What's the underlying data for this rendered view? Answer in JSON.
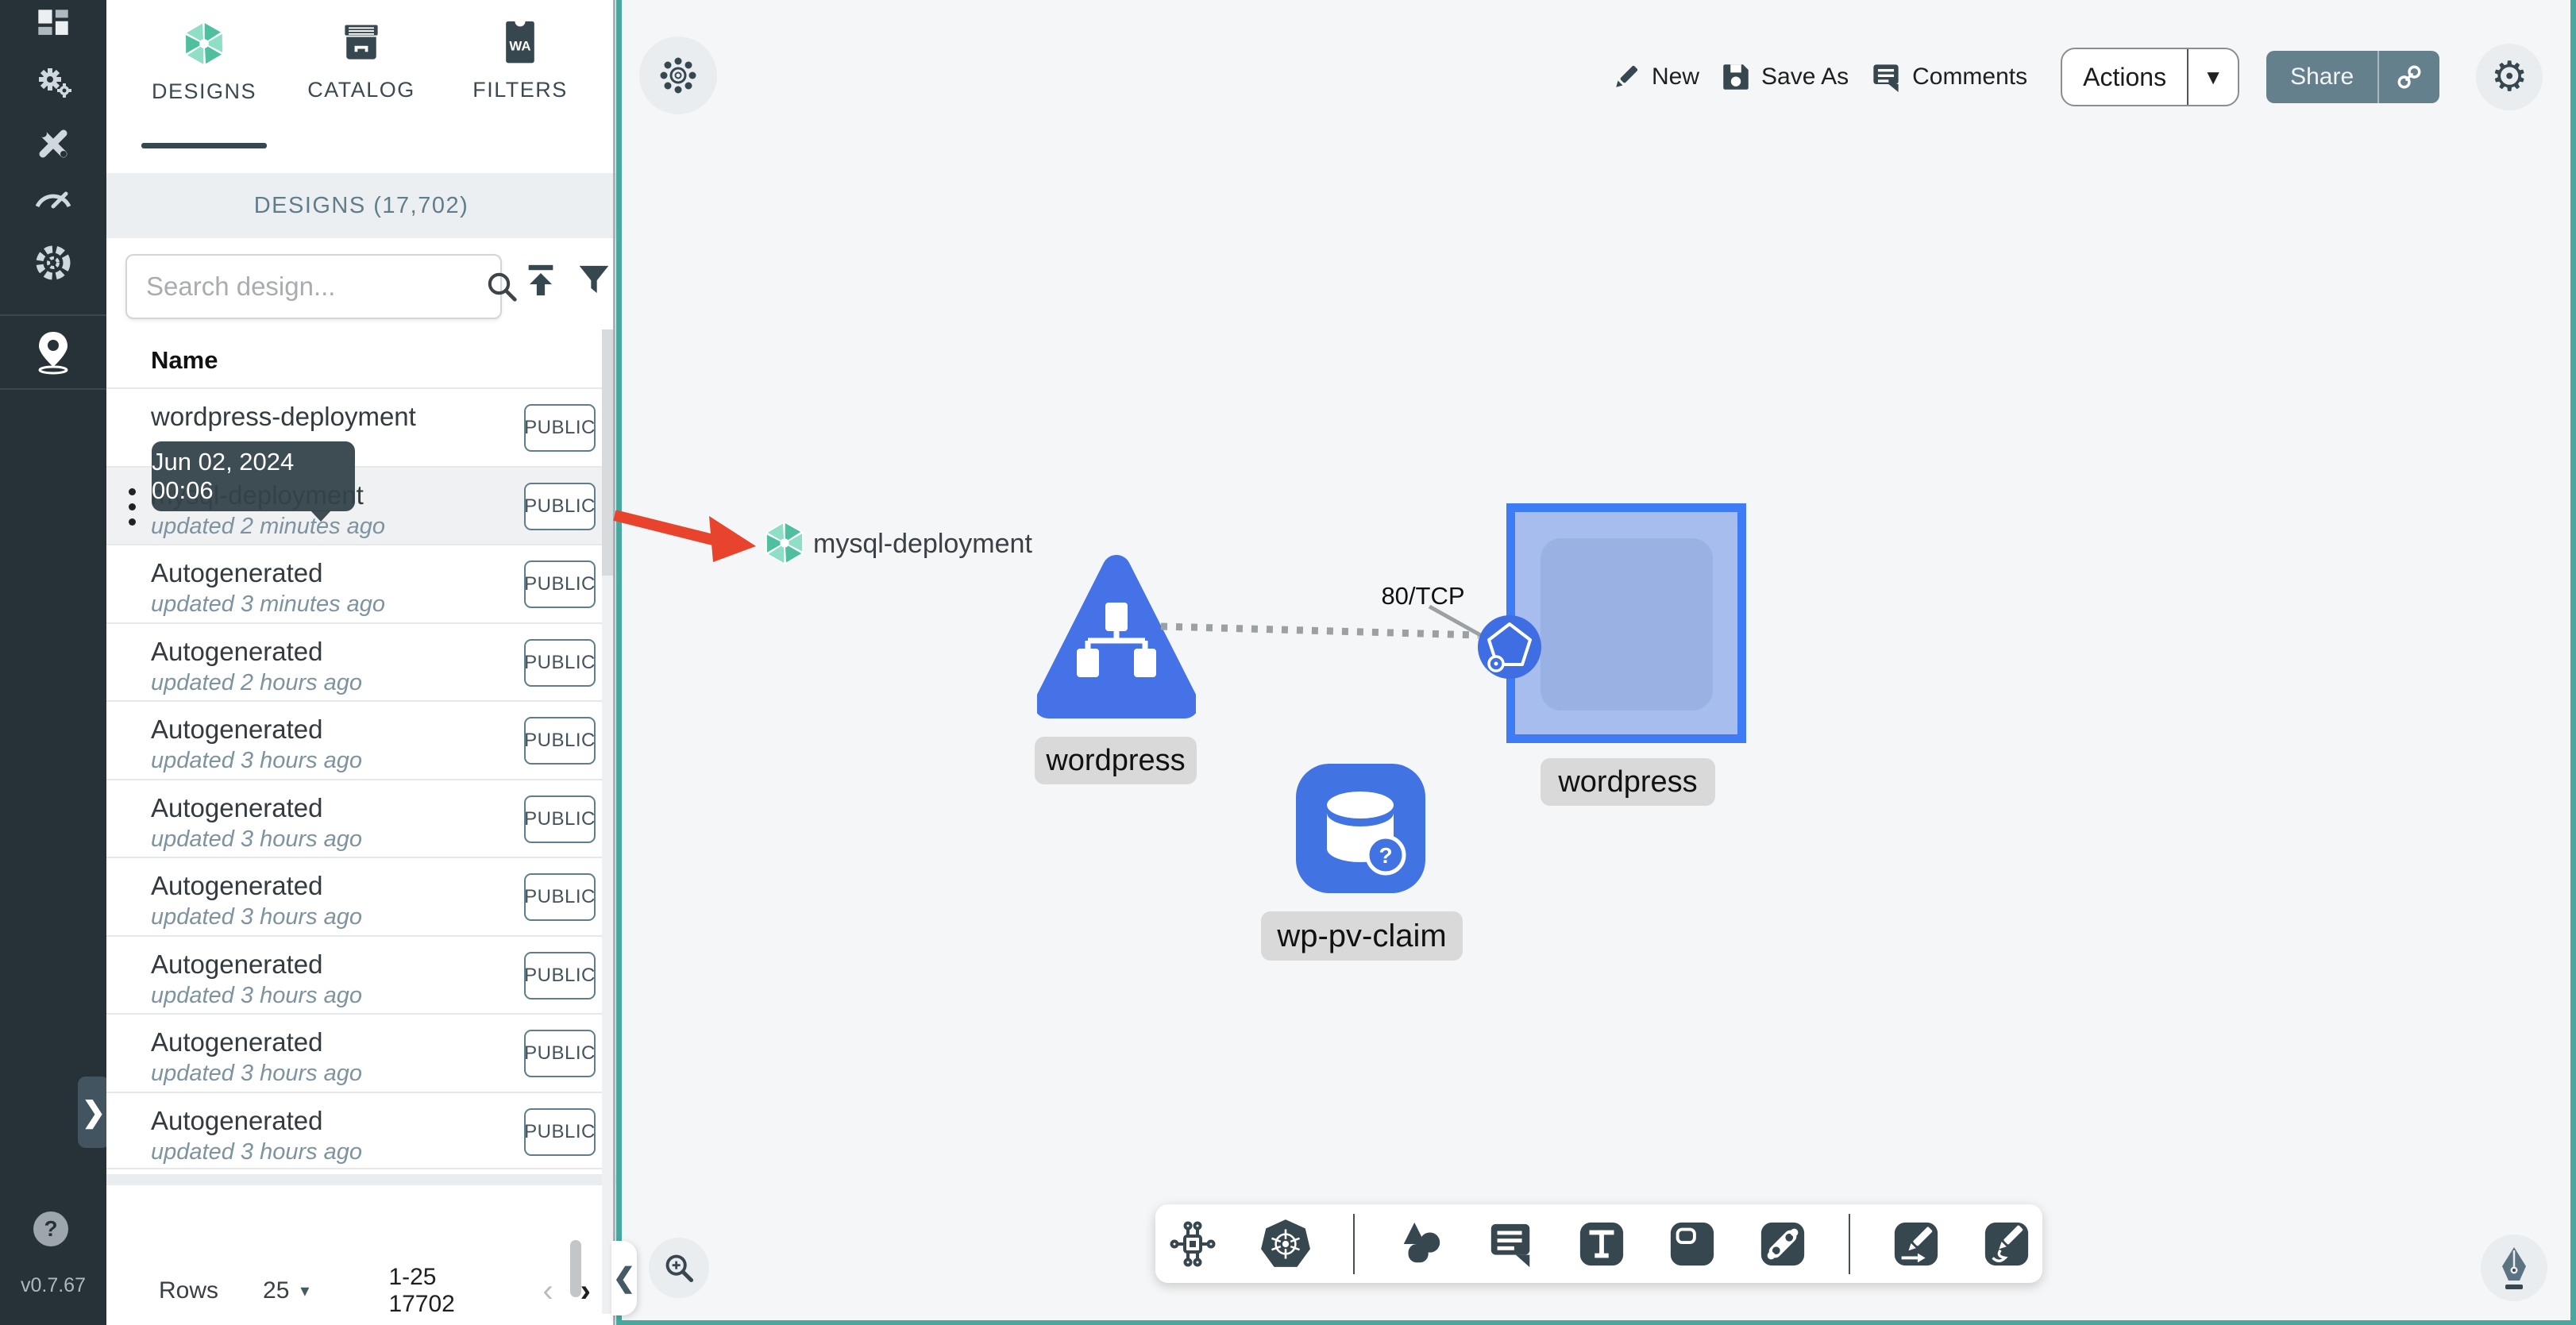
{
  "version": "v0.7.67",
  "nav": {
    "items": [
      "dashboard-icon",
      "lifecycle-icon",
      "configuration-icon",
      "performance-icon",
      "extensions-icon",
      "kanvas-pin-icon"
    ],
    "help": "?",
    "expand": "❯"
  },
  "tabs": [
    {
      "label": "DESIGNS",
      "icon": "meshery-logo-icon",
      "active": true
    },
    {
      "label": "CATALOG",
      "icon": "catalog-archive-icon",
      "active": false
    },
    {
      "label": "FILTERS",
      "icon": "filters-wasm-icon",
      "active": false
    }
  ],
  "panel": {
    "header": "DESIGNS (17,702)",
    "search_placeholder": "Search design...",
    "column_header": "Name",
    "tooltip": "Jun 02, 2024 00:06",
    "rows": [
      {
        "name": "wordpress-deployment",
        "updated": "",
        "badge": "PUBLIC",
        "hovered": false
      },
      {
        "name": "mysql-deployment",
        "updated": "updated 2 minutes ago",
        "badge": "PUBLIC",
        "hovered": true
      },
      {
        "name": "Autogenerated",
        "updated": "updated 3 minutes ago",
        "badge": "PUBLIC",
        "hovered": false
      },
      {
        "name": "Autogenerated",
        "updated": "updated 2 hours ago",
        "badge": "PUBLIC",
        "hovered": false
      },
      {
        "name": "Autogenerated",
        "updated": "updated 3 hours ago",
        "badge": "PUBLIC",
        "hovered": false
      },
      {
        "name": "Autogenerated",
        "updated": "updated 3 hours ago",
        "badge": "PUBLIC",
        "hovered": false
      },
      {
        "name": "Autogenerated",
        "updated": "updated 3 hours ago",
        "badge": "PUBLIC",
        "hovered": false
      },
      {
        "name": "Autogenerated",
        "updated": "updated 3 hours ago",
        "badge": "PUBLIC",
        "hovered": false
      },
      {
        "name": "Autogenerated",
        "updated": "updated 3 hours ago",
        "badge": "PUBLIC",
        "hovered": false
      },
      {
        "name": "Autogenerated",
        "updated": "updated 3 hours ago",
        "badge": "PUBLIC",
        "hovered": false
      }
    ],
    "pagination": {
      "rows_label": "Rows",
      "per_page": "25",
      "range": "1-25 17702",
      "prev": "‹",
      "next": "›"
    }
  },
  "toolbar": {
    "new": "New",
    "save_as": "Save As",
    "comments": "Comments",
    "actions": "Actions",
    "share": "Share"
  },
  "canvas": {
    "selected_design": "mysql-deployment",
    "edge_label": "80/TCP",
    "nodes": [
      {
        "label": "wordpress",
        "type": "deployment-triangle"
      },
      {
        "label": "wordpress",
        "type": "container-square"
      },
      {
        "label": "wp-pv-claim",
        "type": "persistent-volume-claim"
      }
    ]
  },
  "dock": {
    "tools": [
      "component-explorer",
      "kubernetes",
      "shapes",
      "comment",
      "text",
      "note",
      "relationship",
      "edge-pen",
      "freehand-pen"
    ]
  },
  "colors": {
    "teal_border": "#48a89f",
    "nav_bg": "#263238",
    "slate": "#37474f",
    "node_blue": "#4573e7",
    "square_border": "#3e7cf6",
    "square_fill": "#a6bdee",
    "red_arrow": "#e8432c",
    "share_bg": "#64808d",
    "chip_bg": "#d9d9d9"
  }
}
